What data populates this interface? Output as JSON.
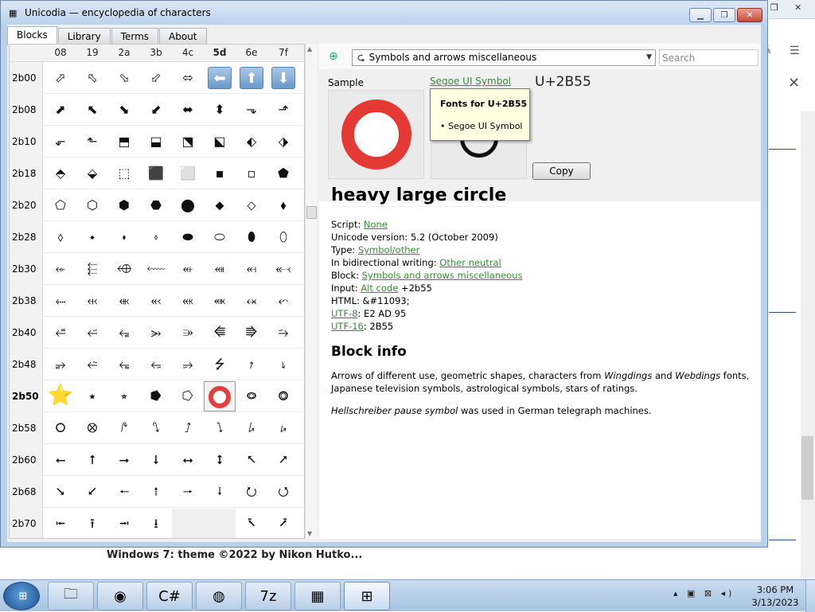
{
  "window": {
    "title": "Unicodia — encyclopedia of characters",
    "min_glyph": "▭",
    "max_glyph": "❐",
    "close_glyph": "✕"
  },
  "tabs": [
    "Blocks",
    "Library",
    "Terms",
    "About"
  ],
  "grid": {
    "columns": [
      "08",
      "19",
      "2a",
      "3b",
      "4c",
      "5d",
      "6e",
      "7f"
    ],
    "bold_column": "5d",
    "rows": [
      {
        "label": "2b00",
        "cells": [
          "⬀",
          "⬁",
          "⬂",
          "⬃",
          "⬄",
          "⬅",
          "⬆",
          "⬇"
        ]
      },
      {
        "label": "2b08",
        "cells": [
          "⬈",
          "⬉",
          "⬊",
          "⬋",
          "⬌",
          "⬍",
          "⬎",
          "⬏"
        ]
      },
      {
        "label": "2b10",
        "cells": [
          "⬐",
          "⬑",
          "⬒",
          "⬓",
          "⬔",
          "⬕",
          "⬖",
          "⬗"
        ]
      },
      {
        "label": "2b18",
        "cells": [
          "⬘",
          "⬙",
          "⬚",
          "⬛",
          "⬜",
          "▪",
          "▫",
          "⬟"
        ]
      },
      {
        "label": "2b20",
        "cells": [
          "⬠",
          "⬡",
          "⬢",
          "⬣",
          "⬤",
          "⬥",
          "⬦",
          "⬧"
        ]
      },
      {
        "label": "2b28",
        "cells": [
          "⬨",
          "⬩",
          "⬪",
          "⬫",
          "⬬",
          "⬭",
          "⬮",
          "⬯"
        ]
      },
      {
        "label": "2b30",
        "cells": [
          "⬰",
          "⬱",
          "⬲",
          "⬳",
          "⬴",
          "⬵",
          "⬶",
          "⬷"
        ]
      },
      {
        "label": "2b38",
        "cells": [
          "⬸",
          "⬹",
          "⬺",
          "⬻",
          "⬼",
          "⬽",
          "⬾",
          "⬿"
        ]
      },
      {
        "label": "2b40",
        "cells": [
          "⭀",
          "⭁",
          "⭂",
          "⭃",
          "⭄",
          "⭅",
          "⭆",
          "⭇"
        ]
      },
      {
        "label": "2b48",
        "cells": [
          "⭈",
          "⭉",
          "⭊",
          "⭋",
          "⭌",
          "⭍",
          "⭎",
          "⭏"
        ]
      },
      {
        "label": "2b50",
        "cells": [
          "⭐",
          "⭑",
          "⭒",
          "⭓",
          "⭔",
          "⭕",
          "⭖",
          "⭗"
        ]
      },
      {
        "label": "2b58",
        "cells": [
          "⭘",
          "⭙",
          "⭚",
          "⭛",
          "⭜",
          "⭝",
          "⭞",
          "⭟"
        ]
      },
      {
        "label": "2b60",
        "cells": [
          "⭠",
          "⭡",
          "⭢",
          "⭣",
          "⭤",
          "⭥",
          "⭦",
          "⭧"
        ]
      },
      {
        "label": "2b68",
        "cells": [
          "⭨",
          "⭩",
          "⭪",
          "⭫",
          "⭬",
          "⭭",
          "⭮",
          "⭯"
        ]
      },
      {
        "label": "2b70",
        "cells": [
          "⭰",
          "⭱",
          "⭲",
          "⭳",
          "",
          "",
          "⭶",
          "⭷"
        ]
      }
    ],
    "selected_row": "2b50",
    "selected_col": 5
  },
  "toolbar": {
    "block_glyph": "⮎",
    "block_select_value": "Symbols and arrows miscellaneous",
    "search_placeholder": "Search",
    "globe_glyph": "⊕"
  },
  "sample": {
    "label": "Sample",
    "font_link": "Segoe UI Symbol",
    "code_point": "U+2B55",
    "copy_label": "Copy",
    "tooltip_title": "Fonts for U+2B55",
    "tooltip_item": "• Segoe UI Symbol"
  },
  "details": {
    "name": "heavy large circle",
    "script_label": "Script: ",
    "script_value": "None",
    "unicode_version": "Unicode version: 5.2 (October 2009)",
    "type_label": "Type: ",
    "type_value": "Symbol/other",
    "bidi_label": "In bidirectional writing: ",
    "bidi_value": "Other neutral",
    "block_label": "Block: ",
    "block_value": "Symbols and arrows miscellaneous",
    "input_label": "Input: ",
    "input_link": "Alt code",
    "input_value": " +2b55",
    "html_line": "HTML: &#11093;",
    "utf8_link": "UTF-8",
    "utf8_value": ": E2 AD 95",
    "utf16_link": "UTF-16",
    "utf16_value": ": 2B55"
  },
  "block_info": {
    "title": "Block info",
    "desc_1": "Arrows of different use, geometric shapes, characters from ",
    "desc_em1": "Wingdings",
    "desc_2": " and ",
    "desc_em2": "Webdings",
    "desc_3": " fonts, Japanese television symbols, astrological symbols, stars of ratings.",
    "note_em": "Hellschreiber pause symbol",
    "note_rest": " was used in German telegraph machines."
  },
  "background": {
    "under_text": "Windows 7: theme ©2022 by Nikon Hutko..."
  },
  "taskbar": {
    "apps": [
      "explorer-icon",
      "chrome-icon",
      "csharp-icon",
      "firefox-icon",
      "7zip-icon",
      "winrar-icon",
      "unicodia-icon"
    ],
    "app_glyphs": [
      "🗀",
      "◉",
      "C#",
      "◍",
      "7z",
      "▦",
      "⊞"
    ],
    "tray_glyphs": "▴ ▣ ⊠ ◂)",
    "time": "3:06 PM",
    "date": "3/13/2023"
  }
}
